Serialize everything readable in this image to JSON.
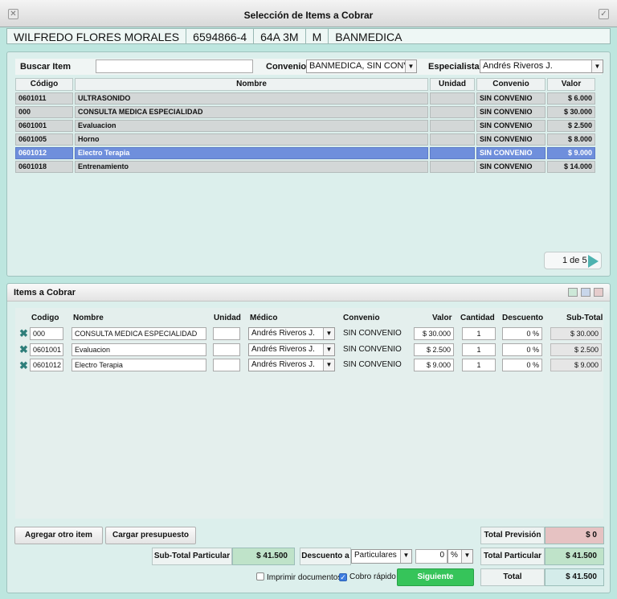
{
  "window": {
    "title": "Selección de Items a Cobrar"
  },
  "patient": {
    "name": "WILFREDO FLORES MORALES",
    "id": "6594866-4",
    "age": "64A 3M",
    "sex": "M",
    "insurer": "BANMEDICA"
  },
  "search": {
    "buscar_label": "Buscar Item",
    "buscar_value": "",
    "convenio_label": "Convenio",
    "convenio_value": "BANMEDICA, SIN CONVE...",
    "especialista_label": "Especialista",
    "especialista_value": "Andrés Riveros J."
  },
  "catalog": {
    "headers": {
      "codigo": "Código",
      "nombre": "Nombre",
      "unidad": "Unidad",
      "convenio": "Convenio",
      "valor": "Valor"
    },
    "rows": [
      {
        "codigo": "0601011",
        "nombre": "ULTRASONIDO",
        "unidad": "",
        "convenio": "SIN CONVENIO",
        "valor": "$ 6.000"
      },
      {
        "codigo": "000",
        "nombre": "CONSULTA MEDICA ESPECIALIDAD",
        "unidad": "",
        "convenio": "SIN CONVENIO",
        "valor": "$ 30.000"
      },
      {
        "codigo": "0601001",
        "nombre": "Evaluacion",
        "unidad": "",
        "convenio": "SIN CONVENIO",
        "valor": "$ 2.500"
      },
      {
        "codigo": "0601005",
        "nombre": "Horno",
        "unidad": "",
        "convenio": "SIN CONVENIO",
        "valor": "$ 8.000"
      },
      {
        "codigo": "0601012",
        "nombre": "Electro Terapia",
        "unidad": "",
        "convenio": "SIN CONVENIO",
        "valor": "$ 9.000"
      },
      {
        "codigo": "0601018",
        "nombre": "Entrenamiento",
        "unidad": "",
        "convenio": "SIN CONVENIO",
        "valor": "$ 14.000"
      }
    ],
    "pager": "1 de 5"
  },
  "items": {
    "title": "Items a Cobrar",
    "headers": {
      "codigo": "Codigo",
      "nombre": "Nombre",
      "unidad": "Unidad",
      "medico": "Médico",
      "convenio": "Convenio",
      "valor": "Valor",
      "cantidad": "Cantidad",
      "descuento": "Descuento",
      "subtotal": "Sub-Total"
    },
    "rows": [
      {
        "codigo": "000",
        "nombre": "CONSULTA MEDICA ESPECIALIDAD",
        "unidad": "",
        "medico": "Andrés Riveros J.",
        "convenio": "SIN CONVENIO",
        "valor": "$ 30.000",
        "cantidad": "1",
        "descuento": "0 %",
        "subtotal": "$ 30.000"
      },
      {
        "codigo": "0601001",
        "nombre": "Evaluacion",
        "unidad": "",
        "medico": "Andrés Riveros J.",
        "convenio": "SIN CONVENIO",
        "valor": "$ 2.500",
        "cantidad": "1",
        "descuento": "0 %",
        "subtotal": "$ 2.500"
      },
      {
        "codigo": "0601012",
        "nombre": "Electro Terapia",
        "unidad": "",
        "medico": "Andrés Riveros J.",
        "convenio": "SIN CONVENIO",
        "valor": "$ 9.000",
        "cantidad": "1",
        "descuento": "0 %",
        "subtotal": "$ 9.000"
      }
    ]
  },
  "footer": {
    "agregar_label": "Agregar otro item",
    "cargar_label": "Cargar presupuesto",
    "subtotal_particular_label": "Sub-Total Particular",
    "subtotal_particular_value": "$ 41.500",
    "descuento_label": "Descuento a",
    "descuento_target": "Particulares",
    "descuento_value": "0",
    "descuento_unit": "%",
    "imprimir_label": "Imprimir documentos",
    "imprimir_checked": false,
    "cobro_label": "Cobro rápido",
    "cobro_checked": true,
    "siguiente_label": "Siguiente",
    "total_prevision_label": "Total Previsión",
    "total_prevision_value": "$ 0",
    "total_particular_label": "Total Particular",
    "total_particular_value": "$ 41.500",
    "total_label": "Total",
    "total_value": "$ 41.500"
  },
  "colors": {
    "selected_row": "#6f8fdc",
    "accent_green": "#36c45a",
    "window_bg": "#bde6df"
  }
}
